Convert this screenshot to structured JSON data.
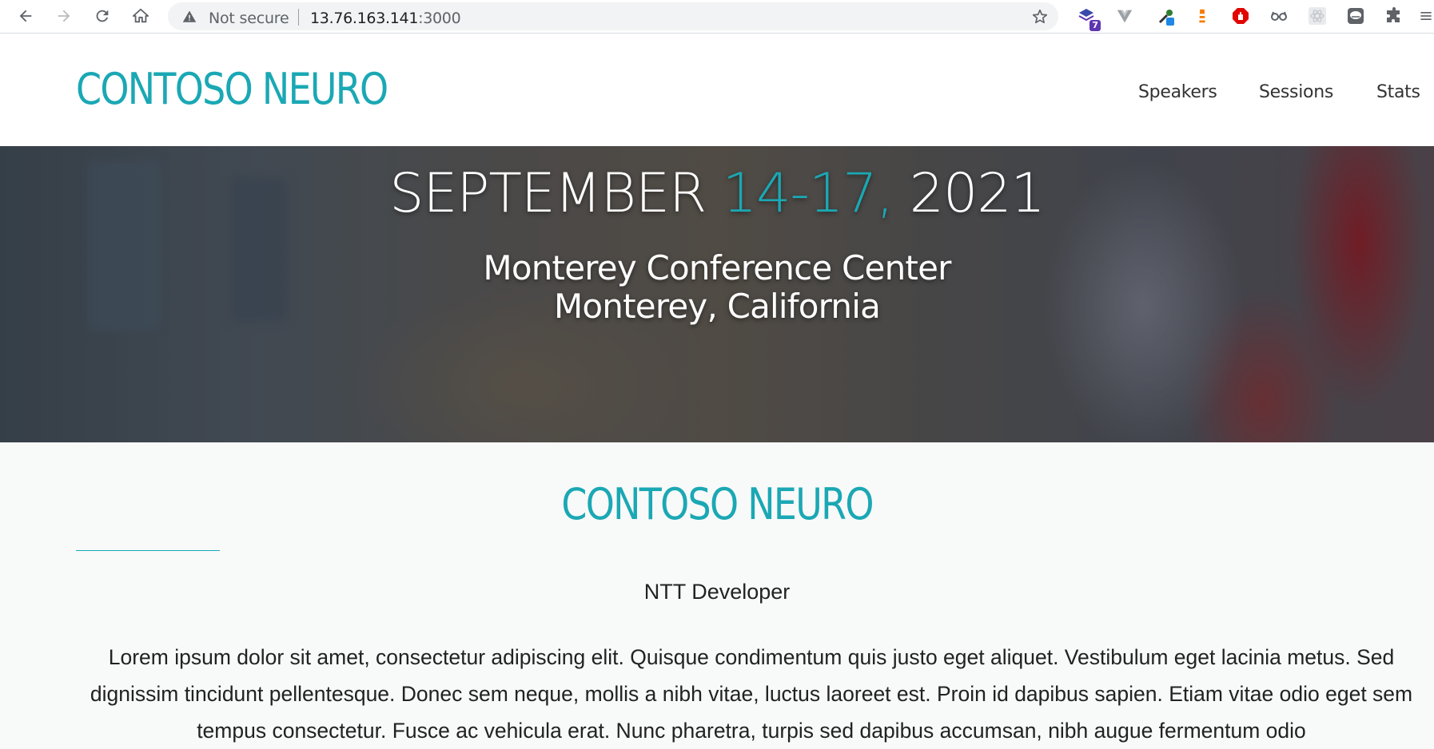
{
  "browser": {
    "security_label": "Not secure",
    "url_host": "13.76.163.141",
    "url_port": ":3000",
    "extension_badge": "7"
  },
  "site": {
    "logo": "CONTOSO NEURO",
    "nav": [
      "Speakers",
      "Sessions",
      "Stats"
    ]
  },
  "hero": {
    "date_month": "SEPTEMBER",
    "date_days": "14-17,",
    "date_year": "2021",
    "venue_line1": "Monterey Conference Center",
    "venue_line2": "Monterey, California"
  },
  "content": {
    "logo": "CONTOSO NEURO",
    "subtitle": "NTT Developer",
    "paragraph": "Lorem ipsum dolor sit amet, consectetur adipiscing elit. Quisque condimentum quis justo eget aliquet. Vestibulum eget lacinia metus. Sed dignissim tincidunt pellentesque. Donec sem neque, mollis a nibh vitae, luctus laoreet est. Proin id dapibus sapien. Etiam vitae odio eget sem tempus consectetur. Fusce ac vehicula erat. Nunc pharetra, turpis sed dapibus accumsan, nibh augue fermentum odio"
  },
  "colors": {
    "accent": "#1aa8b4",
    "text": "#222222"
  }
}
